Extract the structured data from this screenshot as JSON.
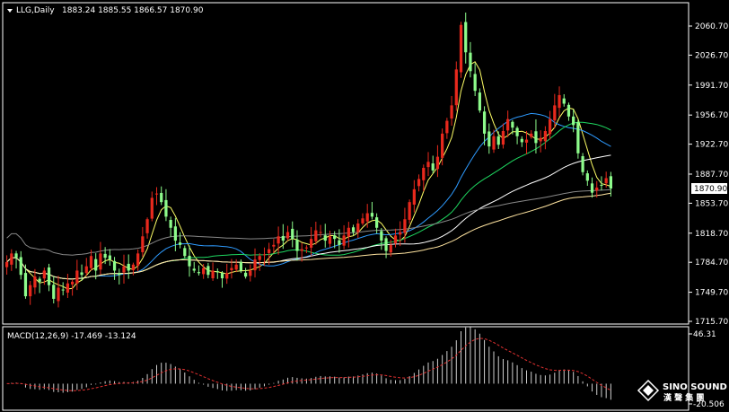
{
  "chart_data": [
    {
      "type": "candlestick",
      "symbol_label": "LLG,Daily",
      "ohlc_readout": "1883.24 1885.55 1866.57 1870.90",
      "current_price_label": "1870.90",
      "y_ticks": [
        "2060.70",
        "2026.70",
        "1991.70",
        "1956.70",
        "1922.70",
        "1887.70",
        "1853.70",
        "1818.70",
        "1784.70",
        "1749.70",
        "1715.70"
      ],
      "ylim": [
        1715.7,
        2077
      ],
      "close_series": [
        1785,
        1795,
        1790,
        1770,
        1745,
        1758,
        1768,
        1762,
        1775,
        1758,
        1742,
        1755,
        1752,
        1760,
        1762,
        1775,
        1770,
        1780,
        1792,
        1775,
        1795,
        1790,
        1788,
        1775,
        1770,
        1780,
        1775,
        1782,
        1795,
        1815,
        1835,
        1860,
        1865,
        1855,
        1838,
        1825,
        1810,
        1805,
        1792,
        1780,
        1775,
        1772,
        1778,
        1770,
        1775,
        1773,
        1766,
        1772,
        1778,
        1782,
        1775,
        1768,
        1775,
        1788,
        1792,
        1794,
        1800,
        1805,
        1815,
        1810,
        1820,
        1812,
        1798,
        1800,
        1802,
        1812,
        1822,
        1820,
        1810,
        1815,
        1812,
        1805,
        1816,
        1825,
        1820,
        1830,
        1836,
        1842,
        1838,
        1825,
        1810,
        1798,
        1805,
        1816,
        1820,
        1835,
        1855,
        1870,
        1882,
        1895,
        1902,
        1892,
        1908,
        1935,
        1950,
        1968,
        2010,
        2062,
        2030,
        2008,
        1985,
        1962,
        1935,
        1920,
        1932,
        1922,
        1938,
        1952,
        1942,
        1932,
        1925,
        1928,
        1935,
        1924,
        1930,
        1938,
        1952,
        1968,
        1980,
        1970,
        1955,
        1945,
        1912,
        1890,
        1880,
        1866,
        1872,
        1875,
        1883,
        1870.9
      ],
      "ma_colors": {
        "ma_fast": "#ffff66",
        "ma_blue": "#2e9bff",
        "ma_green": "#1ed760",
        "ma_white": "#ffffff",
        "ma_beige": "#ffe4a0",
        "ma_gray": "#888888"
      },
      "bull_color": "#e8291d",
      "bear_color": "#8dfb8b",
      "background": "#000000"
    },
    {
      "type": "histogram",
      "indicator_label": "MACD(12,26,9) -17.469 -13.124",
      "y_ticks": [
        "46.31",
        "-20.506"
      ],
      "ylim": [
        -20.506,
        46.31
      ],
      "hist_color": "#cfcfcf",
      "signal_color": "#e03030"
    }
  ],
  "watermark": {
    "logo_text": "SINO SOUND",
    "cn_text": "漢 聲 集 團"
  }
}
